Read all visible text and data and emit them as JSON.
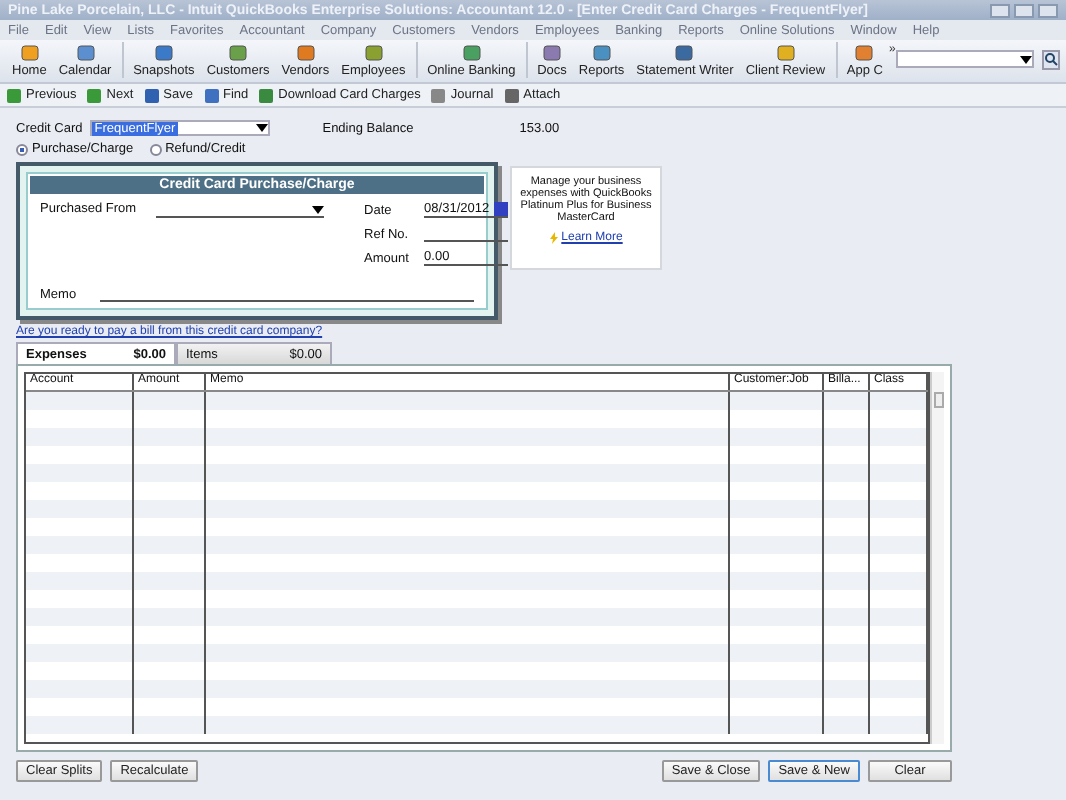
{
  "window": {
    "title": "Pine Lake Porcelain, LLC  - Intuit QuickBooks Enterprise Solutions: Accountant 12.0 - [Enter Credit Card Charges - FrequentFlyer]"
  },
  "menu": [
    "File",
    "Edit",
    "View",
    "Lists",
    "Favorites",
    "Accountant",
    "Company",
    "Customers",
    "Vendors",
    "Employees",
    "Banking",
    "Reports",
    "Online Solutions",
    "Window",
    "Help"
  ],
  "icon_bar": [
    "Home",
    "Calendar",
    "Snapshots",
    "Customers",
    "Vendors",
    "Employees",
    "Online Banking",
    "Docs",
    "Reports",
    "Statement Writer",
    "Client Review",
    "App C"
  ],
  "overflow": "»",
  "actions": [
    "Previous",
    "Next",
    "Save",
    "Find",
    "Download Card Charges",
    "Journal",
    "Attach"
  ],
  "form": {
    "credit_card_label": "Credit Card",
    "credit_card": "FrequentFlyer",
    "ending_balance_label": "Ending Balance",
    "ending_balance": "153.00",
    "modes": [
      {
        "label": "Purchase/Charge",
        "selected": true
      },
      {
        "label": "Refund/Credit",
        "selected": false
      }
    ],
    "panel_title": "Credit Card Purchase/Charge",
    "purchased_from_label": "Purchased From",
    "date_label": "Date",
    "date": "08/31/2012",
    "ref_label": "Ref No.",
    "amount_label": "Amount",
    "amount": "0.00",
    "memo_label": "Memo"
  },
  "ad": {
    "text": "Manage your business expenses with QuickBooks Platinum Plus for Business MasterCard",
    "link": "Learn More"
  },
  "pay_link": "Are you ready to pay a bill from this credit card company?",
  "tabs": [
    {
      "label": "Expenses",
      "amount": "$0.00",
      "selected": true
    },
    {
      "label": "Items",
      "amount": "$0.00",
      "selected": false
    }
  ],
  "table": {
    "columns": [
      "Account",
      "Amount",
      "Memo",
      "Customer:Job",
      "Billa...",
      "Class"
    ]
  },
  "buttons_left": [
    "Clear Splits",
    "Recalculate"
  ],
  "buttons_right": [
    {
      "label": "Save & Close",
      "default": false
    },
    {
      "label": "Save & New",
      "default": true
    },
    {
      "label": "Clear",
      "default": false
    }
  ]
}
